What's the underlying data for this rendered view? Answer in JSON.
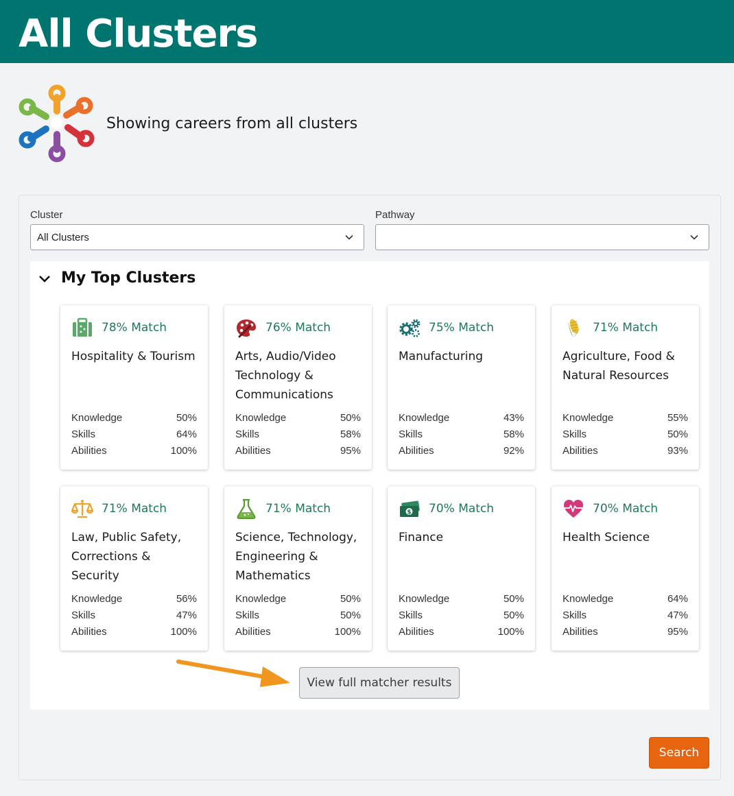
{
  "header": {
    "title": "All Clusters"
  },
  "intro": {
    "text": "Showing careers from all clusters",
    "logo_icon": "clusters-logo-icon"
  },
  "filters": {
    "cluster_label": "Cluster",
    "cluster_value": "All Clusters",
    "pathway_label": "Pathway",
    "pathway_value": ""
  },
  "top_clusters": {
    "title": "My Top Clusters",
    "cards": [
      {
        "match": "78% Match",
        "name": "Hospitality & Tourism",
        "icon": "suitcase-icon",
        "icon_color": "#5aa86a",
        "knowledge": "50%",
        "skills": "64%",
        "abilities": "100%"
      },
      {
        "match": "76% Match",
        "name": "Arts, Audio/Video Technology & Communications",
        "icon": "palette-icon",
        "icon_color": "#b3282d",
        "knowledge": "50%",
        "skills": "58%",
        "abilities": "95%"
      },
      {
        "match": "75% Match",
        "name": "Manufacturing",
        "icon": "gears-icon",
        "icon_color": "#1f6f7a",
        "knowledge": "43%",
        "skills": "58%",
        "abilities": "92%"
      },
      {
        "match": "71% Match",
        "name": "Agriculture, Food & Natural Resources",
        "icon": "corn-icon",
        "icon_color": "#7ab648",
        "knowledge": "55%",
        "skills": "50%",
        "abilities": "93%"
      },
      {
        "match": "71% Match",
        "name": "Law, Public Safety, Corrections & Security",
        "icon": "scales-icon",
        "icon_color": "#f0a22a",
        "knowledge": "56%",
        "skills": "47%",
        "abilities": "100%"
      },
      {
        "match": "71% Match",
        "name": "Science, Technology, Engineering & Mathematics",
        "icon": "flask-icon",
        "icon_color": "#7ab648",
        "knowledge": "50%",
        "skills": "50%",
        "abilities": "100%"
      },
      {
        "match": "70% Match",
        "name": "Finance",
        "icon": "money-icon",
        "icon_color": "#1d6b4a",
        "knowledge": "50%",
        "skills": "50%",
        "abilities": "100%"
      },
      {
        "match": "70% Match",
        "name": "Health Science",
        "icon": "heart-icon",
        "icon_color": "#d2387a",
        "knowledge": "64%",
        "skills": "47%",
        "abilities": "95%"
      }
    ],
    "stat_labels": {
      "knowledge": "Knowledge",
      "skills": "Skills",
      "abilities": "Abilities"
    }
  },
  "buttons": {
    "view_full": "View full matcher results",
    "search": "Search"
  },
  "colors": {
    "header_bg": "#00746e",
    "match_text": "#1d7a55",
    "search_bg": "#e8650f",
    "arrow": "#f0961e"
  }
}
